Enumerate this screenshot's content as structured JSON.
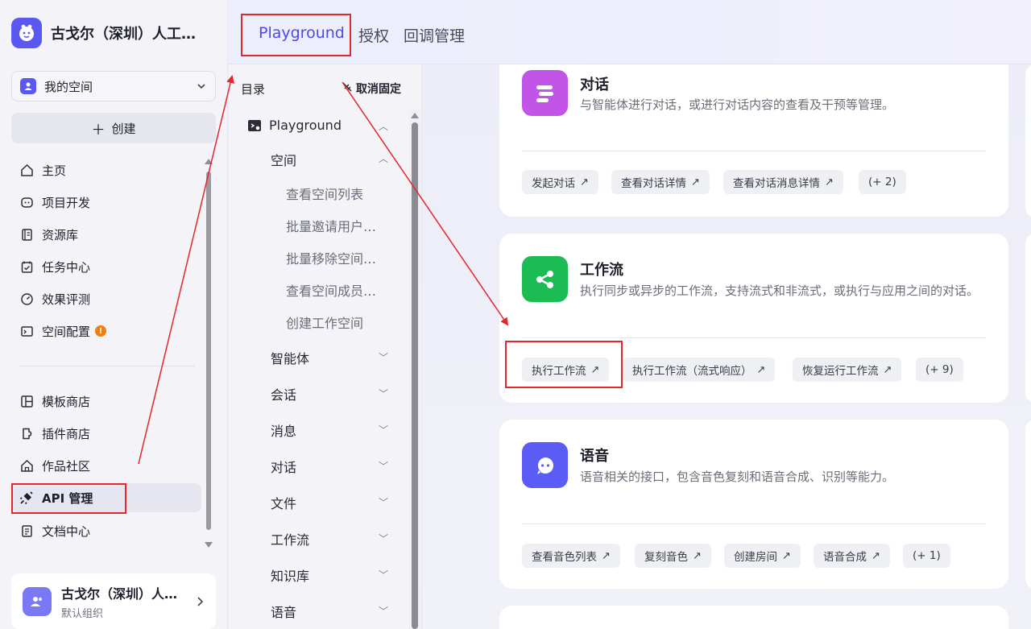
{
  "sidebar": {
    "brand_name": "古戈尔（深圳）人工…",
    "space_label": "我的空间",
    "create_label": "创建",
    "nav_items": [
      {
        "label": "主页",
        "icon": "home-icon"
      },
      {
        "label": "项目开发",
        "icon": "robot-icon"
      },
      {
        "label": "资源库",
        "icon": "library-icon"
      },
      {
        "label": "任务中心",
        "icon": "task-icon"
      },
      {
        "label": "效果评测",
        "icon": "gauge-icon"
      },
      {
        "label": "空间配置",
        "icon": "terminal-icon",
        "badge": "!"
      },
      {
        "label": "模板商店",
        "icon": "template-icon"
      },
      {
        "label": "插件商店",
        "icon": "plugin-icon"
      },
      {
        "label": "作品社区",
        "icon": "community-icon"
      },
      {
        "label": "API 管理",
        "icon": "api-icon",
        "active": true
      },
      {
        "label": "文档中心",
        "icon": "document-icon"
      }
    ],
    "user": {
      "name": "古戈尔（深圳）人…",
      "org": "默认组织"
    }
  },
  "topbar": {
    "tabs": [
      {
        "label": "Playground",
        "active": true
      },
      {
        "label": "授权"
      },
      {
        "label": "回调管理"
      }
    ]
  },
  "toc": {
    "heading": "目录",
    "unpin_label": "取消固定",
    "root": "Playground",
    "section_space": "空间",
    "space_items": [
      "查看空间列表",
      "批量邀请用户…",
      "批量移除空间…",
      "查看空间成员…",
      "创建工作空间"
    ],
    "sections": [
      "智能体",
      "会话",
      "消息",
      "对话",
      "文件",
      "工作流",
      "知识库",
      "语音"
    ]
  },
  "cards": [
    {
      "title": "对话",
      "desc": "与智能体进行对话，或进行对话内容的查看及干预等管理。",
      "icon": "chat-lines-icon",
      "color": "#c254e8",
      "chips": [
        "发起对话",
        "查看对话详情",
        "查看对话消息详情",
        "(+ 2)"
      ]
    },
    {
      "title": "工作流",
      "desc": "执行同步或异步的工作流，支持流式和非流式，或执行与应用之间的对话。",
      "icon": "workflow-icon",
      "color": "#1cbc55",
      "chips": [
        "执行工作流",
        "执行工作流（流式响应）",
        "恢复运行工作流",
        "(+ 9)"
      ]
    },
    {
      "title": "语音",
      "desc": "语音相关的接口，包含音色复刻和语音合成、识别等能力。",
      "icon": "voice-bubble-icon",
      "color": "#5b5cf6",
      "chips": [
        "查看音色列表",
        "复刻音色",
        "创建房间",
        "语音合成",
        "(+ 1)"
      ]
    }
  ],
  "colors": {
    "accent": "#4d49e8",
    "highlight_red": "#e5262a"
  }
}
